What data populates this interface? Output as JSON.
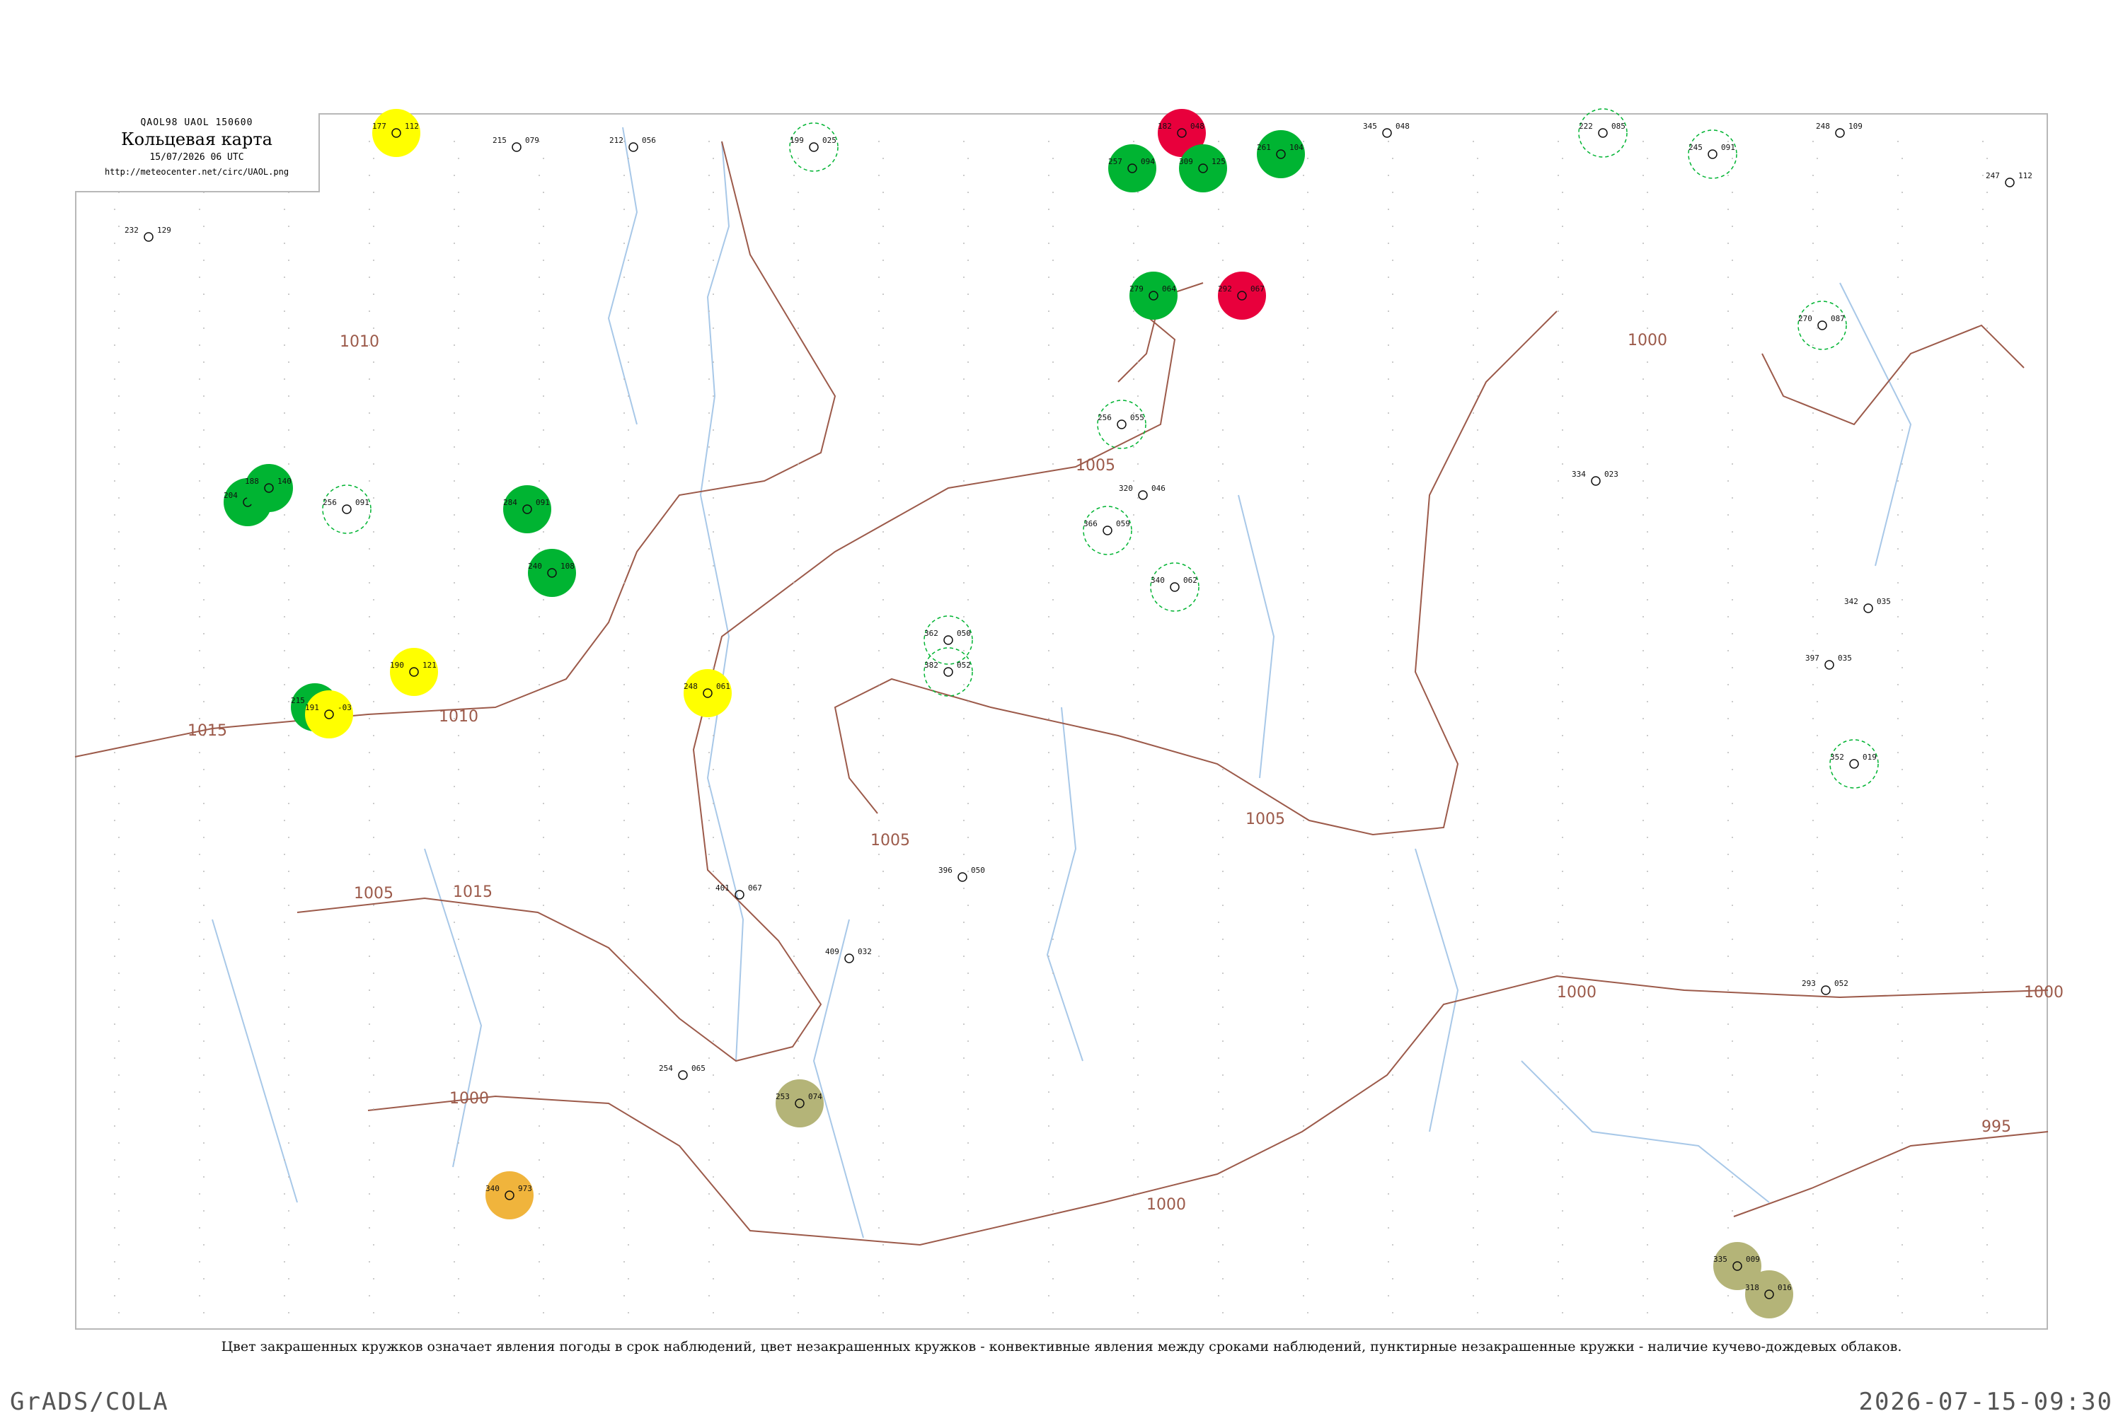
{
  "header": {
    "codes": "QAOL98  UAOL  150600",
    "title": "Кольцевая карта",
    "time": "15/07/2026 06 UTC",
    "url": "http://meteocenter.net/circ/UAOL.png"
  },
  "caption": "Цвет закрашенных кружков означает явления погоды в срок наблюдений, цвет незакрашенных кружков - конвективные явления между сроками наблюдений, пунктирные незакрашенные кружки - наличие кучево-дождевых облаков.",
  "footer": {
    "left": "GrADS/COLA",
    "right": "2026-07-15-09:30"
  },
  "colors": {
    "frame": "#b8b8b8",
    "isobar": "#9c5a4a",
    "river": "#a8c8e8",
    "rain": "#00b432",
    "thunder": "#e8003c",
    "fog": "#ffff00",
    "haze": "#b4b478",
    "dust": "#f0b43c",
    "cb_dashed": "#00b432"
  },
  "isobar_labels": [
    {
      "value": "1015"
    },
    {
      "value": "1010"
    },
    {
      "value": "1010"
    },
    {
      "value": "1005"
    },
    {
      "value": "1005"
    },
    {
      "value": "1005"
    },
    {
      "value": "1005"
    },
    {
      "value": "1000"
    },
    {
      "value": "1000"
    },
    {
      "value": "1000"
    },
    {
      "value": "1000"
    },
    {
      "value": "1000"
    },
    {
      "value": "995"
    },
    {
      "value": "1015"
    }
  ],
  "stations": [
    {
      "t": "232",
      "p": "129",
      "type": "plain"
    },
    {
      "t": "177",
      "p": "112",
      "type": "fog"
    },
    {
      "t": "215",
      "p": "079",
      "type": "plain"
    },
    {
      "t": "212",
      "p": "056",
      "type": "plain"
    },
    {
      "t": "199",
      "p": "025",
      "type": "cb"
    },
    {
      "t": "182",
      "p": "048",
      "type": "thunder"
    },
    {
      "t": "345",
      "p": "048",
      "type": "plain"
    },
    {
      "t": "222",
      "p": "085",
      "type": "cb"
    },
    {
      "t": "248",
      "p": "109",
      "type": "plain"
    },
    {
      "t": "245",
      "p": "091",
      "type": "cb"
    },
    {
      "t": "247",
      "p": "112",
      "type": "plain"
    },
    {
      "t": "261",
      "p": "104",
      "type": "rain"
    },
    {
      "t": "309",
      "p": "125",
      "type": "rain"
    },
    {
      "t": "257",
      "p": "094",
      "type": "rain"
    },
    {
      "t": "292",
      "p": "067",
      "type": "thunder"
    },
    {
      "t": "279",
      "p": "064",
      "type": "rain"
    },
    {
      "t": "204",
      "p": "125",
      "type": "rain"
    },
    {
      "t": "188",
      "p": "140",
      "type": "rain"
    },
    {
      "t": "215",
      "p": "191",
      "type": "rain"
    },
    {
      "t": "190",
      "p": "121",
      "type": "fog"
    },
    {
      "t": "191",
      "p": "-03",
      "type": "fog"
    },
    {
      "t": "248",
      "p": "061",
      "type": "fog"
    },
    {
      "t": "253",
      "p": "074",
      "type": "haze"
    },
    {
      "t": "340",
      "p": "973",
      "type": "dust"
    },
    {
      "t": "335",
      "p": "009",
      "type": "haze"
    },
    {
      "t": "318",
      "p": "016",
      "type": "haze"
    },
    {
      "t": "254",
      "p": "065",
      "type": "plain"
    },
    {
      "t": "256",
      "p": "091",
      "type": "cb"
    },
    {
      "t": "362",
      "p": "050",
      "type": "cb"
    },
    {
      "t": "382",
      "p": "052",
      "type": "cb"
    },
    {
      "t": "366",
      "p": "059",
      "type": "cb"
    },
    {
      "t": "256",
      "p": "055",
      "type": "cb"
    },
    {
      "t": "334",
      "p": "023",
      "type": "plain"
    },
    {
      "t": "340",
      "p": "062",
      "type": "cb"
    },
    {
      "t": "397",
      "p": "035",
      "type": "plain"
    },
    {
      "t": "320",
      "p": "046",
      "type": "plain"
    },
    {
      "t": "342",
      "p": "035",
      "type": "plain"
    },
    {
      "t": "396",
      "p": "050",
      "type": "plain"
    },
    {
      "t": "401",
      "p": "067",
      "type": "plain"
    },
    {
      "t": "409",
      "p": "032",
      "type": "plain"
    },
    {
      "t": "352",
      "p": "019",
      "type": "cb"
    },
    {
      "t": "270",
      "p": "087",
      "type": "cb"
    },
    {
      "t": "284",
      "p": "091",
      "type": "rain"
    },
    {
      "t": "240",
      "p": "108",
      "type": "rain"
    },
    {
      "t": "293",
      "p": "052",
      "type": "plain"
    }
  ]
}
